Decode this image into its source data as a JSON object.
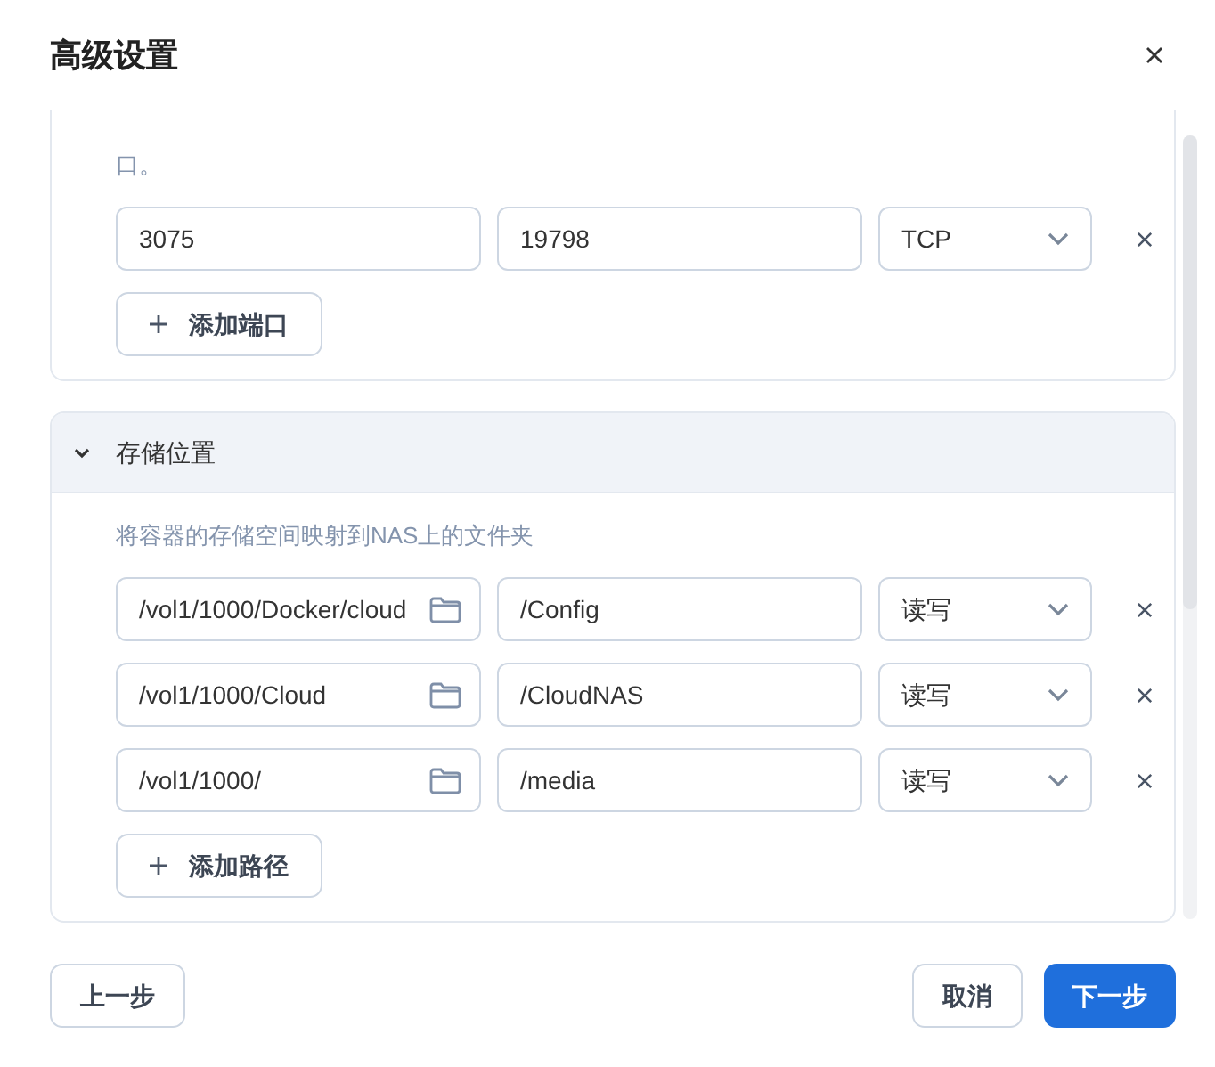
{
  "dialog": {
    "title": "高级设置"
  },
  "port_section": {
    "description": "口。",
    "rows": [
      {
        "host_port": "3075",
        "container_port": "19798",
        "protocol": "TCP"
      }
    ],
    "add_button": "添加端口"
  },
  "storage_section": {
    "title": "存储位置",
    "expanded": true,
    "description": "将容器的存储空间映射到NAS上的文件夹",
    "rows": [
      {
        "host_path": "/vol1/1000/Docker/cloud",
        "container_path": "/Config",
        "mode": "读写"
      },
      {
        "host_path": "/vol1/1000/Cloud",
        "container_path": "/CloudNAS",
        "mode": "读写"
      },
      {
        "host_path": "/vol1/1000/",
        "container_path": "/media",
        "mode": "读写"
      }
    ],
    "add_button": "添加路径"
  },
  "footer": {
    "back": "上一步",
    "cancel": "取消",
    "next": "下一步"
  }
}
